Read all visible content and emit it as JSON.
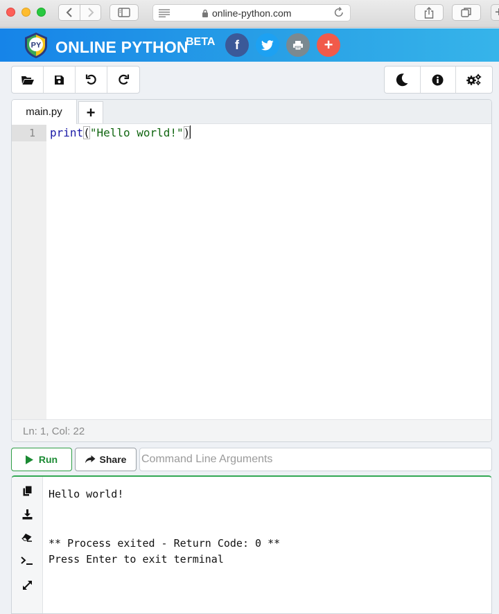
{
  "browser": {
    "url": "online-python.com",
    "back_icon": "chevron-left-icon",
    "forward_icon": "chevron-right-icon"
  },
  "header": {
    "logo_text": "PY",
    "brand": "ONLINE PYTHON",
    "beta": "BETA",
    "social": {
      "facebook": "f",
      "more": "+"
    },
    "colors": {
      "gradient_start": "#1684e8",
      "gradient_end": "#36b4ea",
      "facebook": "#3b5998",
      "twitter": "#1da1f2",
      "print": "#7b8990",
      "more": "#f15a4a"
    }
  },
  "toolbar": {
    "left": [
      "folder-open-icon",
      "save-icon",
      "undo-icon",
      "redo-icon"
    ],
    "right": [
      "moon-icon",
      "info-icon",
      "settings-gears-icon"
    ]
  },
  "editor": {
    "tabs": [
      {
        "label": "main.py"
      }
    ],
    "add_tab_label": "+",
    "lines": [
      {
        "number": "1",
        "keyword": "print",
        "open_paren": "(",
        "string": "\"Hello world!\"",
        "close_paren": ")"
      }
    ],
    "status": "Ln: 1,  Col: 22"
  },
  "actions": {
    "run_label": "Run",
    "share_label": "Share",
    "args_placeholder": "Command Line Arguments",
    "run_color": "#1b8a33"
  },
  "terminal": {
    "sidebar_icons": [
      "copy-icon",
      "download-icon",
      "eraser-icon",
      "terminal-prompt-icon",
      "expand-icon"
    ],
    "output": "Hello world!\n\n\n** Process exited - Return Code: 0 **\nPress Enter to exit terminal"
  }
}
